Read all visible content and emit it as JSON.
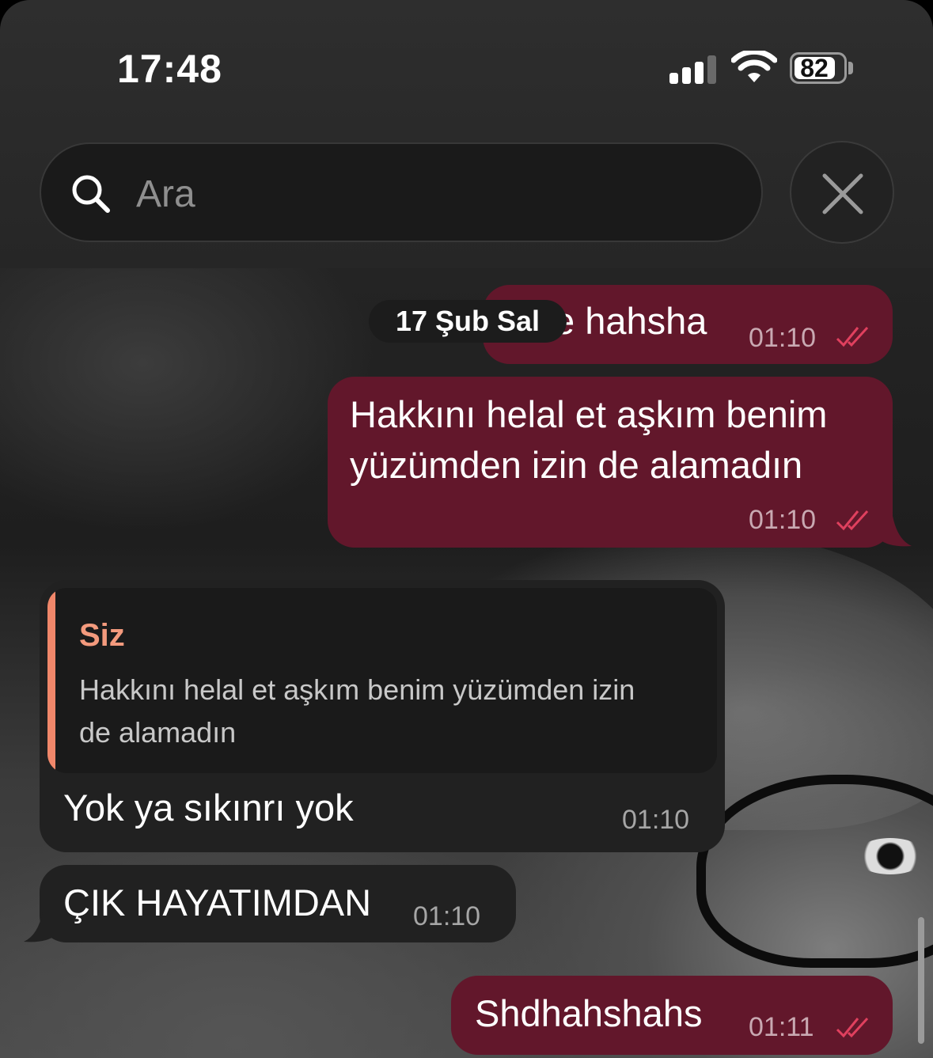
{
  "status_bar": {
    "time": "17:48",
    "battery": "82"
  },
  "search": {
    "placeholder": "Ara"
  },
  "chat": {
    "date_label": "17 Şub Sal",
    "messages": [
      {
        "direction": "out",
        "text": "e hahsha",
        "time": "01:10",
        "read": true
      },
      {
        "direction": "out",
        "text_line1": "Hakkını helal et aşkım benim",
        "text_line2": "yüzümden izin de alamadın",
        "time": "01:10",
        "read": true
      },
      {
        "direction": "in",
        "reply_to": {
          "name": "Siz",
          "text_line1": "Hakkını helal et aşkım benim yüzümden izin",
          "text_line2": "de alamadın"
        },
        "text": "Yok ya sıkınrı yok",
        "time": "01:10"
      },
      {
        "direction": "in",
        "text": "ÇIK HAYATIMDAN",
        "time": "01:10"
      },
      {
        "direction": "out",
        "text": "Shdhahshahs",
        "time": "01:11",
        "read": true
      }
    ]
  },
  "colors": {
    "outgoing_bubble": "#62172b",
    "incoming_bubble": "#212121",
    "reply_accent": "#f0876a",
    "read_ticks": "#e0405e"
  }
}
